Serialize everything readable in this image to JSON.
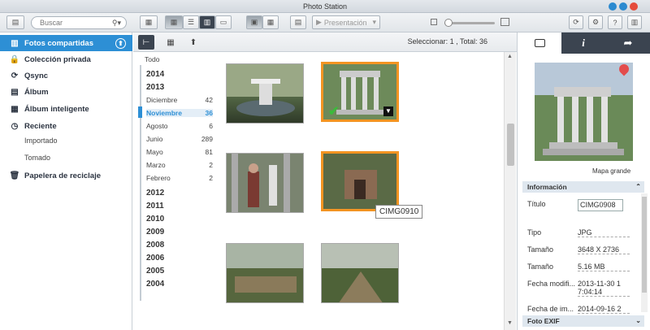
{
  "window": {
    "title": "Photo Station"
  },
  "search": {
    "placeholder": "Buscar"
  },
  "toolbar": {
    "presentacion_label": "Presentación"
  },
  "sidebar": {
    "items": [
      {
        "label": "Fotos compartidas",
        "icon": "shared-photos-icon"
      },
      {
        "label": "Colección privada",
        "icon": "lock-icon"
      },
      {
        "label": "Qsync",
        "icon": "sync-icon"
      },
      {
        "label": "Álbum",
        "icon": "album-icon"
      },
      {
        "label": "Álbum inteligente",
        "icon": "smart-album-icon"
      },
      {
        "label": "Reciente",
        "icon": "clock-icon"
      },
      {
        "label": "Papelera de reciclaje",
        "icon": "trash-icon"
      }
    ],
    "sub": [
      {
        "label": "Importado"
      },
      {
        "label": "Tomado"
      }
    ]
  },
  "selection": {
    "text": "Seleccionar: 1 , Total: 36"
  },
  "timeline": {
    "todo": "Todo",
    "entries": [
      {
        "label": "2014",
        "count": ""
      },
      {
        "label": "2013",
        "count": ""
      },
      {
        "label": "Diciembre",
        "count": "42"
      },
      {
        "label": "Noviembre",
        "count": "36"
      },
      {
        "label": "Agosto",
        "count": "6"
      },
      {
        "label": "Junio",
        "count": "289"
      },
      {
        "label": "Mayo",
        "count": "81"
      },
      {
        "label": "Marzo",
        "count": "2"
      },
      {
        "label": "Febrero",
        "count": "2"
      },
      {
        "label": "2012",
        "count": ""
      },
      {
        "label": "2011",
        "count": ""
      },
      {
        "label": "2010",
        "count": ""
      },
      {
        "label": "2009",
        "count": ""
      },
      {
        "label": "2008",
        "count": ""
      },
      {
        "label": "2006",
        "count": ""
      },
      {
        "label": "2005",
        "count": ""
      },
      {
        "label": "2004",
        "count": ""
      }
    ]
  },
  "tooltip": {
    "text": "CIMG0910"
  },
  "details": {
    "map_label": "Mapa grande",
    "info_header": "Información",
    "exif_header": "Foto EXIF",
    "fields": [
      {
        "label": "Título",
        "value": "CIMG0908"
      },
      {
        "label": "Tipo",
        "value": "JPG"
      },
      {
        "label": "Tamaño",
        "value": "3648 X 2736"
      },
      {
        "label": "Tamaño",
        "value": "5.16 MB"
      },
      {
        "label": "Fecha modifi...",
        "value": "2013-11-30 1\n7:04:14"
      },
      {
        "label": "Fecha de im...",
        "value": "2014-09-16 2"
      }
    ]
  },
  "colors": {
    "accent": "#2d8fd5",
    "selection": "#f39422"
  }
}
